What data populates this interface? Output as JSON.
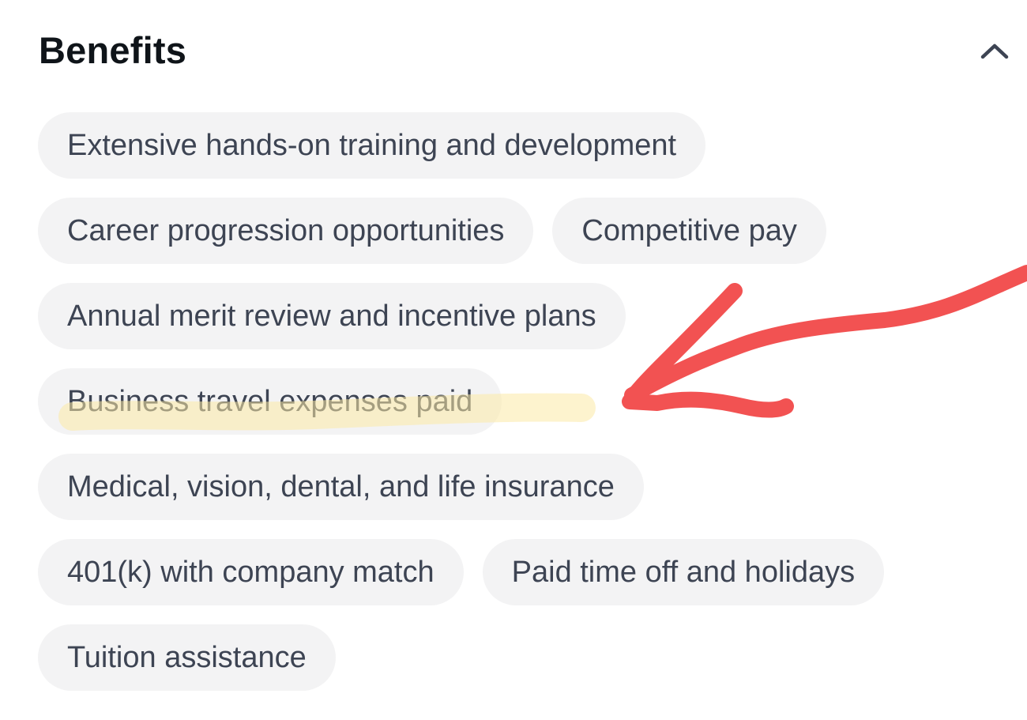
{
  "section": {
    "title": "Benefits",
    "collapse_icon": "chevron-up-icon"
  },
  "benefits": [
    "Extensive hands-on training and development",
    "Career progression opportunities",
    "Competitive pay",
    "Annual merit review and incentive plans",
    "Business travel expenses paid",
    "Medical, vision, dental, and life insurance",
    "401(k) with company match",
    "Paid time off and holidays",
    "Tuition assistance"
  ],
  "annotation": {
    "highlight_color": "#fbe9a6",
    "arrow_color": "#f25252",
    "highlighted_item": "Business travel expenses paid"
  }
}
